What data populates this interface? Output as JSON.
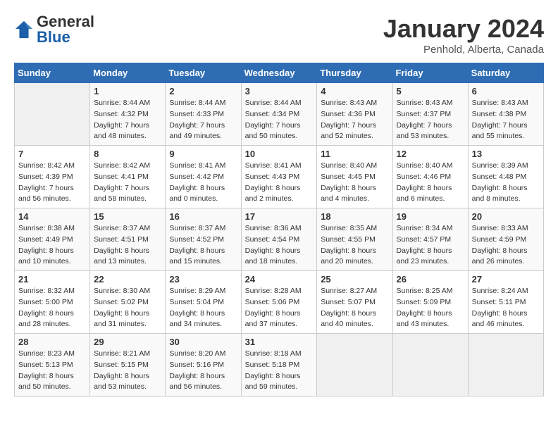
{
  "header": {
    "logo_general": "General",
    "logo_blue": "Blue",
    "month_title": "January 2024",
    "location": "Penhold, Alberta, Canada"
  },
  "days_of_week": [
    "Sunday",
    "Monday",
    "Tuesday",
    "Wednesday",
    "Thursday",
    "Friday",
    "Saturday"
  ],
  "weeks": [
    [
      {
        "day": "",
        "info": ""
      },
      {
        "day": "1",
        "info": "Sunrise: 8:44 AM\nSunset: 4:32 PM\nDaylight: 7 hours\nand 48 minutes."
      },
      {
        "day": "2",
        "info": "Sunrise: 8:44 AM\nSunset: 4:33 PM\nDaylight: 7 hours\nand 49 minutes."
      },
      {
        "day": "3",
        "info": "Sunrise: 8:44 AM\nSunset: 4:34 PM\nDaylight: 7 hours\nand 50 minutes."
      },
      {
        "day": "4",
        "info": "Sunrise: 8:43 AM\nSunset: 4:36 PM\nDaylight: 7 hours\nand 52 minutes."
      },
      {
        "day": "5",
        "info": "Sunrise: 8:43 AM\nSunset: 4:37 PM\nDaylight: 7 hours\nand 53 minutes."
      },
      {
        "day": "6",
        "info": "Sunrise: 8:43 AM\nSunset: 4:38 PM\nDaylight: 7 hours\nand 55 minutes."
      }
    ],
    [
      {
        "day": "7",
        "info": "Sunrise: 8:42 AM\nSunset: 4:39 PM\nDaylight: 7 hours\nand 56 minutes."
      },
      {
        "day": "8",
        "info": "Sunrise: 8:42 AM\nSunset: 4:41 PM\nDaylight: 7 hours\nand 58 minutes."
      },
      {
        "day": "9",
        "info": "Sunrise: 8:41 AM\nSunset: 4:42 PM\nDaylight: 8 hours\nand 0 minutes."
      },
      {
        "day": "10",
        "info": "Sunrise: 8:41 AM\nSunset: 4:43 PM\nDaylight: 8 hours\nand 2 minutes."
      },
      {
        "day": "11",
        "info": "Sunrise: 8:40 AM\nSunset: 4:45 PM\nDaylight: 8 hours\nand 4 minutes."
      },
      {
        "day": "12",
        "info": "Sunrise: 8:40 AM\nSunset: 4:46 PM\nDaylight: 8 hours\nand 6 minutes."
      },
      {
        "day": "13",
        "info": "Sunrise: 8:39 AM\nSunset: 4:48 PM\nDaylight: 8 hours\nand 8 minutes."
      }
    ],
    [
      {
        "day": "14",
        "info": "Sunrise: 8:38 AM\nSunset: 4:49 PM\nDaylight: 8 hours\nand 10 minutes."
      },
      {
        "day": "15",
        "info": "Sunrise: 8:37 AM\nSunset: 4:51 PM\nDaylight: 8 hours\nand 13 minutes."
      },
      {
        "day": "16",
        "info": "Sunrise: 8:37 AM\nSunset: 4:52 PM\nDaylight: 8 hours\nand 15 minutes."
      },
      {
        "day": "17",
        "info": "Sunrise: 8:36 AM\nSunset: 4:54 PM\nDaylight: 8 hours\nand 18 minutes."
      },
      {
        "day": "18",
        "info": "Sunrise: 8:35 AM\nSunset: 4:55 PM\nDaylight: 8 hours\nand 20 minutes."
      },
      {
        "day": "19",
        "info": "Sunrise: 8:34 AM\nSunset: 4:57 PM\nDaylight: 8 hours\nand 23 minutes."
      },
      {
        "day": "20",
        "info": "Sunrise: 8:33 AM\nSunset: 4:59 PM\nDaylight: 8 hours\nand 26 minutes."
      }
    ],
    [
      {
        "day": "21",
        "info": "Sunrise: 8:32 AM\nSunset: 5:00 PM\nDaylight: 8 hours\nand 28 minutes."
      },
      {
        "day": "22",
        "info": "Sunrise: 8:30 AM\nSunset: 5:02 PM\nDaylight: 8 hours\nand 31 minutes."
      },
      {
        "day": "23",
        "info": "Sunrise: 8:29 AM\nSunset: 5:04 PM\nDaylight: 8 hours\nand 34 minutes."
      },
      {
        "day": "24",
        "info": "Sunrise: 8:28 AM\nSunset: 5:06 PM\nDaylight: 8 hours\nand 37 minutes."
      },
      {
        "day": "25",
        "info": "Sunrise: 8:27 AM\nSunset: 5:07 PM\nDaylight: 8 hours\nand 40 minutes."
      },
      {
        "day": "26",
        "info": "Sunrise: 8:25 AM\nSunset: 5:09 PM\nDaylight: 8 hours\nand 43 minutes."
      },
      {
        "day": "27",
        "info": "Sunrise: 8:24 AM\nSunset: 5:11 PM\nDaylight: 8 hours\nand 46 minutes."
      }
    ],
    [
      {
        "day": "28",
        "info": "Sunrise: 8:23 AM\nSunset: 5:13 PM\nDaylight: 8 hours\nand 50 minutes."
      },
      {
        "day": "29",
        "info": "Sunrise: 8:21 AM\nSunset: 5:15 PM\nDaylight: 8 hours\nand 53 minutes."
      },
      {
        "day": "30",
        "info": "Sunrise: 8:20 AM\nSunset: 5:16 PM\nDaylight: 8 hours\nand 56 minutes."
      },
      {
        "day": "31",
        "info": "Sunrise: 8:18 AM\nSunset: 5:18 PM\nDaylight: 8 hours\nand 59 minutes."
      },
      {
        "day": "",
        "info": ""
      },
      {
        "day": "",
        "info": ""
      },
      {
        "day": "",
        "info": ""
      }
    ]
  ]
}
